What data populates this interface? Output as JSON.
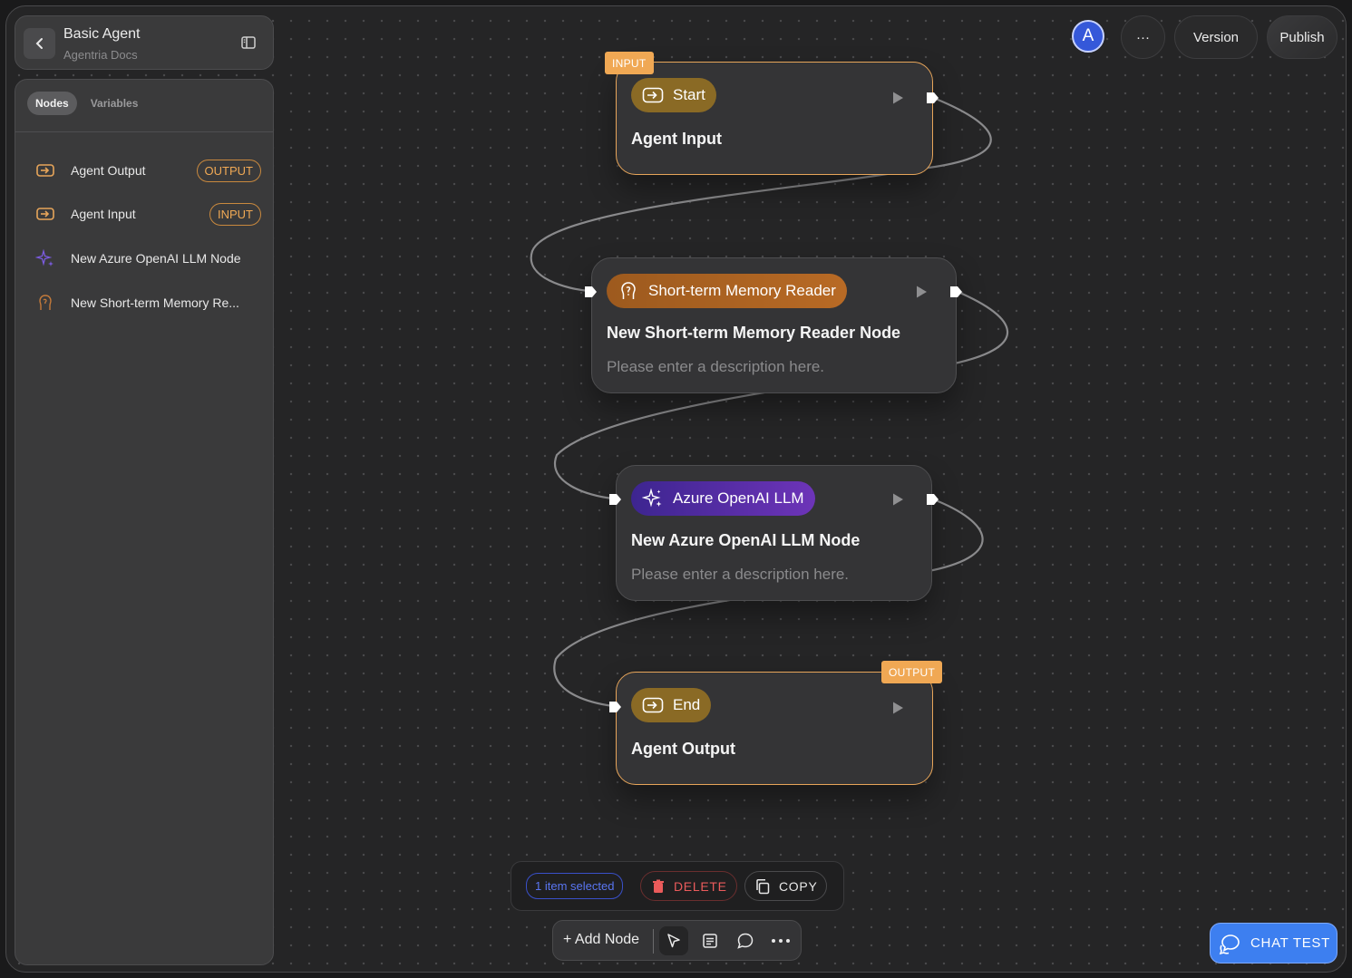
{
  "header": {
    "title": "Basic Agent",
    "subtitle": "Agentria Docs"
  },
  "sidebar": {
    "tabs": [
      {
        "label": "Nodes",
        "active": true
      },
      {
        "label": "Variables",
        "active": false
      }
    ],
    "items": [
      {
        "label": "Agent Output",
        "badge": "OUTPUT",
        "icon": "io-arrow-icon"
      },
      {
        "label": "Agent Input",
        "badge": "INPUT",
        "icon": "io-arrow-icon"
      },
      {
        "label": "New Azure OpenAI LLM Node",
        "badge": "",
        "icon": "sparkle-icon"
      },
      {
        "label": "New Short-term Memory Re...",
        "badge": "",
        "icon": "brain-icon"
      }
    ]
  },
  "topbar": {
    "avatar_initial": "A",
    "more_label": "···",
    "version_label": "Version",
    "publish_label": "Publish"
  },
  "nodes": [
    {
      "type": "Start",
      "title": "Agent Input",
      "tag": "INPUT",
      "description": ""
    },
    {
      "type": "Short-term Memory Reader",
      "title": "New Short-term Memory Reader Node",
      "tag": "",
      "description": "Please enter a description here."
    },
    {
      "type": "Azure OpenAI LLM",
      "title": "New Azure OpenAI LLM Node",
      "tag": "",
      "description": "Please enter a description here."
    },
    {
      "type": "End",
      "title": "Agent Output",
      "tag": "OUTPUT",
      "description": ""
    }
  ],
  "selection_bar": {
    "count_label": "1 item selected",
    "delete_label": "DELETE",
    "copy_label": "COPY"
  },
  "bottom_toolbar": {
    "add_node_label": "+ Add Node"
  },
  "chat_test_label": "CHAT TEST",
  "colors": {
    "accent_orange": "#f0a854",
    "io_chip": "#8a6a25",
    "memory_chip": "#a8581e",
    "llm_chip": "#4b2a9c",
    "primary_blue": "#3d7ff0",
    "danger_red": "#ea5b5b"
  }
}
